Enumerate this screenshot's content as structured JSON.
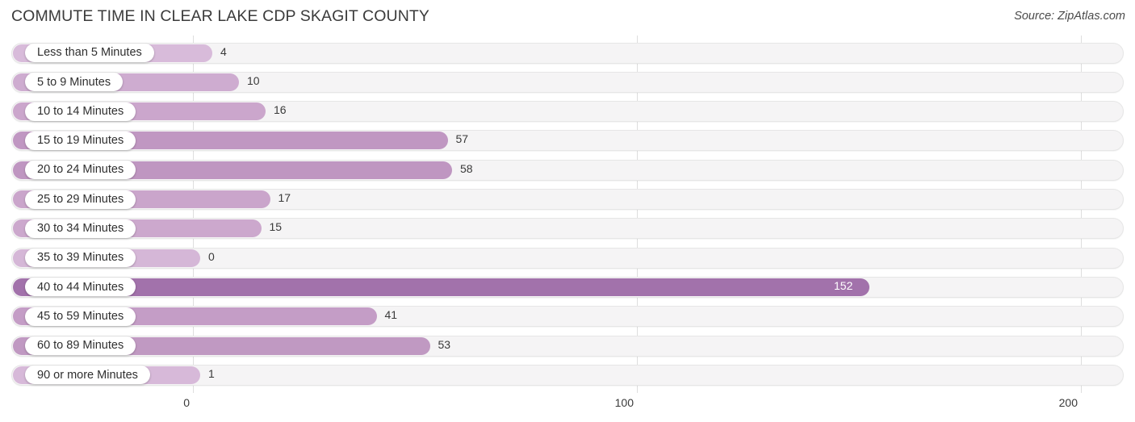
{
  "header": {
    "title": "COMMUTE TIME IN CLEAR LAKE CDP SKAGIT COUNTY",
    "source": "Source: ZipAtlas.com"
  },
  "chart_data": {
    "type": "bar",
    "orientation": "horizontal",
    "title": "COMMUTE TIME IN CLEAR LAKE CDP SKAGIT COUNTY",
    "xlabel": "",
    "ylabel": "",
    "xlim": [
      0,
      200
    ],
    "xticks": [
      0,
      100,
      200
    ],
    "xtick_labels": [
      "0",
      "100",
      "200"
    ],
    "grid": true,
    "legend": null,
    "categories": [
      "Less than 5 Minutes",
      "5 to 9 Minutes",
      "10 to 14 Minutes",
      "15 to 19 Minutes",
      "20 to 24 Minutes",
      "25 to 29 Minutes",
      "30 to 34 Minutes",
      "35 to 39 Minutes",
      "40 to 44 Minutes",
      "45 to 59 Minutes",
      "60 to 89 Minutes",
      "90 or more Minutes"
    ],
    "values": [
      4,
      10,
      16,
      57,
      58,
      17,
      15,
      0,
      152,
      41,
      53,
      1
    ],
    "value_labels": [
      "4",
      "10",
      "16",
      "57",
      "58",
      "17",
      "15",
      "0",
      "152",
      "41",
      "53",
      "1"
    ],
    "bar_colors": [
      "#d8bbda",
      "#ceacd0",
      "#cba6cc",
      "#c097c2",
      "#bf96c1",
      "#caa5cb",
      "#cca8cd",
      "#d5b7d7",
      "#a272ab",
      "#c49dc6",
      "#c099c2",
      "#d7b9d9"
    ]
  },
  "colors": {
    "track": "#f5f4f5",
    "track_border": "#e6e6e6",
    "gridline": "#dedede",
    "text": "#3a3a3a",
    "accent": "#a272ab"
  }
}
